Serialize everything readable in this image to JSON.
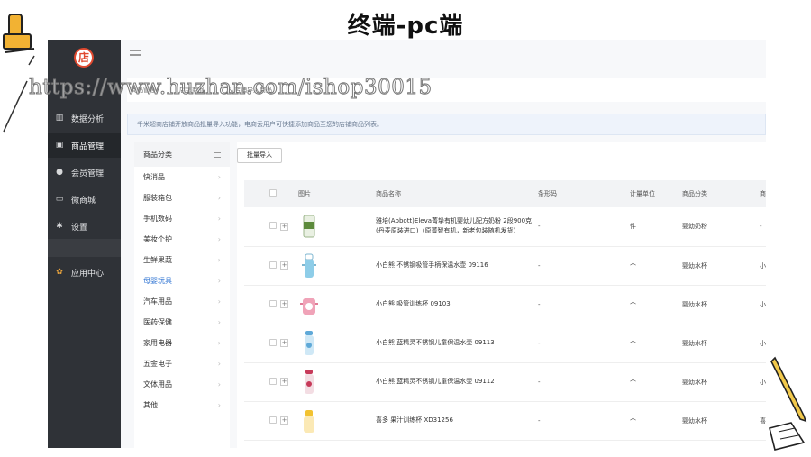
{
  "slide_title": "终端-pc端",
  "watermark": "https://www.huzhan.com/ishop30015",
  "sidebar": {
    "logo": "店",
    "items": [
      {
        "label": "数据分析",
        "icon": "bar-chart-icon"
      },
      {
        "label": "商品管理",
        "icon": "bag-icon",
        "active": true
      },
      {
        "label": "会员管理",
        "icon": "user-icon"
      },
      {
        "label": "微商城",
        "icon": "monitor-icon"
      },
      {
        "label": "设置",
        "icon": "gear-icon"
      },
      {
        "label": "应用中心",
        "icon": "apps-icon"
      }
    ]
  },
  "breadcrumb": [
    "商品管理",
    "店铺商品",
    "从店铺导入商品"
  ],
  "notice": "千米超商店铺开放商品批量导入功能，电商云用户可快捷添加商品至您的店铺商品列表。",
  "categories": {
    "header": "商品分类",
    "items": [
      "快消品",
      "服装箱包",
      "手机数码",
      "美妆个护",
      "生鲜果蔬",
      "母婴玩具",
      "汽车用品",
      "医药保健",
      "家用电器",
      "五金电子",
      "文体用品",
      "其他"
    ],
    "active": "母婴玩具"
  },
  "import_button": "批量导入",
  "table": {
    "headers": [
      "图片",
      "商品名称",
      "条形码",
      "计量单位",
      "商品分类",
      "商"
    ],
    "rows": [
      {
        "name": "雅培(Abbott)Eleva菁挚有机婴幼儿配方奶粉 2段900克 (丹麦原装进口)（原菁智有机，新老包装随机发货）",
        "barcode": "-",
        "unit": "件",
        "category": "婴幼奶粉",
        "extra": "-",
        "img": "formula-can"
      },
      {
        "name": "小白熊 不锈钢吸管手柄保温水壶 09116",
        "barcode": "-",
        "unit": "个",
        "category": "婴幼水杯",
        "extra": "小",
        "img": "blue-bottle"
      },
      {
        "name": "小白熊 吸管训练杯 09103",
        "barcode": "-",
        "unit": "个",
        "category": "婴幼水杯",
        "extra": "小",
        "img": "pink-cup"
      },
      {
        "name": "小白熊 蓝精灵不锈钢儿童保温水壶 09113",
        "barcode": "-",
        "unit": "个",
        "category": "婴幼水杯",
        "extra": "小",
        "img": "lightblue-bottle"
      },
      {
        "name": "小白熊 蓝精灵不锈钢儿童保温水壶 09112",
        "barcode": "-",
        "unit": "个",
        "category": "婴幼水杯",
        "extra": "小",
        "img": "red-bottle"
      },
      {
        "name": "喜多 果汁训练杯 XD31256",
        "barcode": "-",
        "unit": "个",
        "category": "婴幼水杯",
        "extra": "喜",
        "img": "yellow-cup"
      }
    ]
  },
  "colors": {
    "sidebar": "#2f3237",
    "accent": "#3a7bd5",
    "logo": "#e0492f"
  }
}
